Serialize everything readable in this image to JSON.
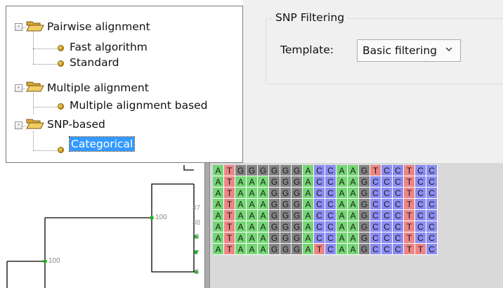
{
  "tree": {
    "nodes": [
      {
        "label": "Pairwise alignment",
        "kind": "folder",
        "expander": "-"
      },
      {
        "label": "Fast algorithm",
        "kind": "leaf"
      },
      {
        "label": "Standard",
        "kind": "leaf"
      },
      {
        "label": "Multiple alignment",
        "kind": "folder",
        "expander": "-"
      },
      {
        "label": "Multiple alignment based",
        "kind": "leaf"
      },
      {
        "label": "SNP-based",
        "kind": "folder",
        "expander": "-"
      },
      {
        "label": "Categorical",
        "kind": "leaf",
        "selected": true
      }
    ]
  },
  "snp_filtering": {
    "title": "SNP Filtering",
    "template_label": "Template:",
    "template_value": "Basic filtering"
  },
  "phylogeny": {
    "bootstrap": [
      "100",
      "100"
    ],
    "leaf_labels": [
      "87",
      "88",
      "8",
      "7",
      "6"
    ]
  },
  "alignment": {
    "colors": {
      "A": "#76d676",
      "T": "#ec8585",
      "G": "#848484",
      "C": "#8c8cf2"
    },
    "rows": [
      "ATGGGGGGACCAAGTCCTCC",
      "ATAAAGGGACCAAGCCCTCC",
      "ATAAAGGGACCAAGCCCTCC",
      "ATAAAGGGACCAAGCCCTCC",
      "ATAAAGGGACCAAGCCCTCC",
      "ATAAAGGGACCAAGCCCTCC",
      "ATAAAGGGACCAAGCCCTCC",
      "ATAAAGGGATCAAGCCCTTC"
    ]
  }
}
